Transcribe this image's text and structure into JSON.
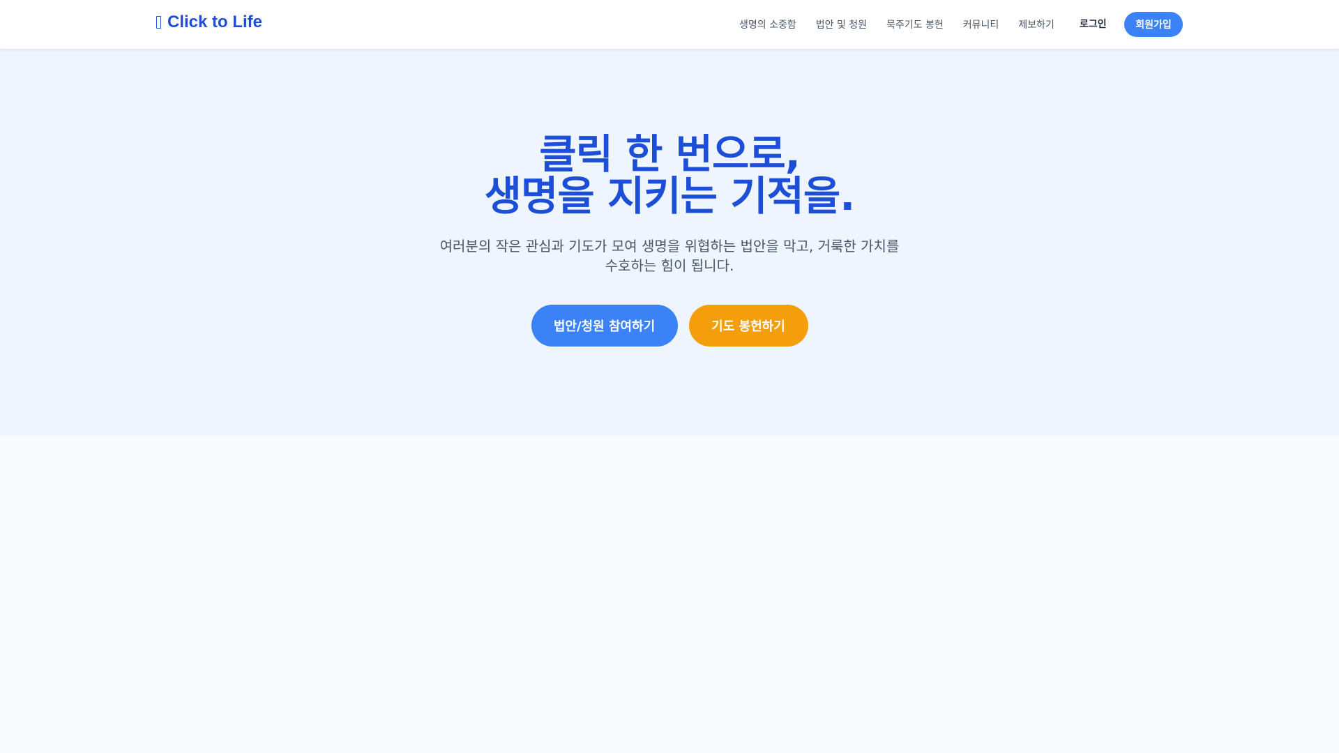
{
  "brand": {
    "name": "Click to Life",
    "icon": "brand-icon"
  },
  "nav": {
    "links": [
      "생명의 소중함",
      "법안 및 청원",
      "묵주기도 봉헌",
      "커뮤니티",
      "제보하기"
    ],
    "login": "로그인",
    "signup": "회원가입"
  },
  "hero": {
    "title_line1": "클릭 한 번으로,",
    "title_line2": "생명을 지키는 기적을.",
    "subtitle": "여러분의 작은 관심과 기도가 모여 생명을 위협하는 법안을 막고, 거룩한 가치를 수호하는 힘이 됩니다.",
    "cta_primary": "법안/청원 참여하기",
    "cta_secondary": "기도 봉헌하기"
  },
  "colors": {
    "brand": "#1d4ed8",
    "primary": "#3b82f6",
    "secondary": "#f59e0b",
    "hero_bg": "#eef5fe",
    "page_bg": "#f8fafc"
  }
}
